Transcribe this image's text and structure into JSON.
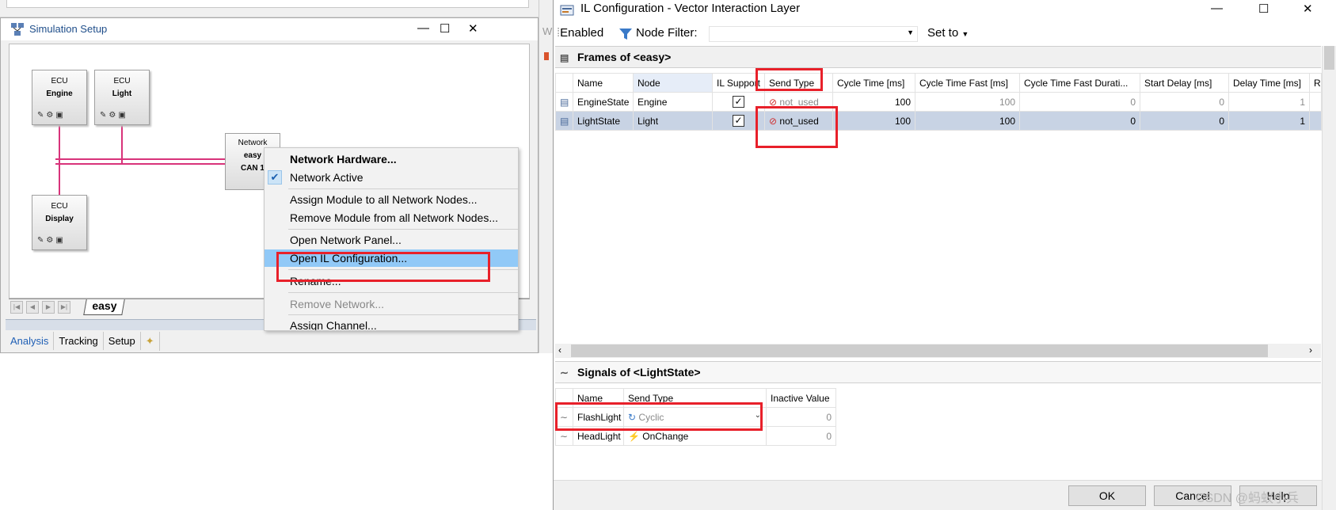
{
  "sim": {
    "title": "Simulation Setup",
    "window_controls": {
      "minimize": "—",
      "maximize": "☐",
      "close": "✕"
    },
    "ecus": [
      {
        "label": "ECU",
        "name": "Engine"
      },
      {
        "label": "ECU",
        "name": "Light"
      },
      {
        "label": "ECU",
        "name": "Display"
      }
    ],
    "network": {
      "label": "Network",
      "name": "easy",
      "channel": "CAN 1"
    },
    "sheet_tab": "easy",
    "bottom_tabs": [
      "Analysis",
      "Tracking",
      "Setup"
    ],
    "accent_color": "#d8337a"
  },
  "context_menu": {
    "items": [
      "Network Hardware...",
      "Network Active",
      "Assign Module to all Network Nodes...",
      "Remove Module from all Network Nodes...",
      "Open Network Panel...",
      "Open IL Configuration...",
      "Rename...",
      "Remove Network...",
      "Assign Channel..."
    ]
  },
  "mid": {
    "letter_w": "W"
  },
  "il": {
    "title": "IL Configuration - Vector Interaction Layer",
    "window_controls": {
      "minimize": "—",
      "maximize": "☐",
      "close": "✕"
    },
    "toolbar": {
      "enabled": "Enabled",
      "node_filter": "Node Filter:",
      "set_to": "Set to"
    },
    "frames_title": "Frames of <easy>",
    "frame_columns": [
      "Name",
      "Node",
      "IL Support",
      "Send Type",
      "Cycle Time [ms]",
      "Cycle Time Fast [ms]",
      "Cycle Time Fast Durati...",
      "Start Delay [ms]",
      "Delay Time [ms]",
      "Rep"
    ],
    "frames": [
      {
        "name": "EngineState",
        "node": "Engine",
        "il_support": "✓",
        "send_type": "not_used",
        "cycle": "100",
        "cycle_fast": "100",
        "cycle_fast_dur": "0",
        "start_delay": "0",
        "delay": "1"
      },
      {
        "name": "LightState",
        "node": "Light",
        "il_support": "✓",
        "send_type": "not_used",
        "cycle": "100",
        "cycle_fast": "100",
        "cycle_fast_dur": "0",
        "start_delay": "0",
        "delay": "1"
      }
    ],
    "signals_title": "Signals of <LightState>",
    "signal_columns": [
      "Name",
      "Send Type",
      "Inactive Value"
    ],
    "signals": [
      {
        "name": "FlashLight",
        "send_type": "Cyclic",
        "inactive": "0"
      },
      {
        "name": "HeadLight",
        "send_type": "OnChange",
        "inactive": "0"
      }
    ],
    "buttons": {
      "ok": "OK",
      "cancel": "Cancel",
      "help": "Help"
    }
  },
  "watermark": "CSDN @蚂蚁小兵",
  "highlight_color": "#e8202a"
}
